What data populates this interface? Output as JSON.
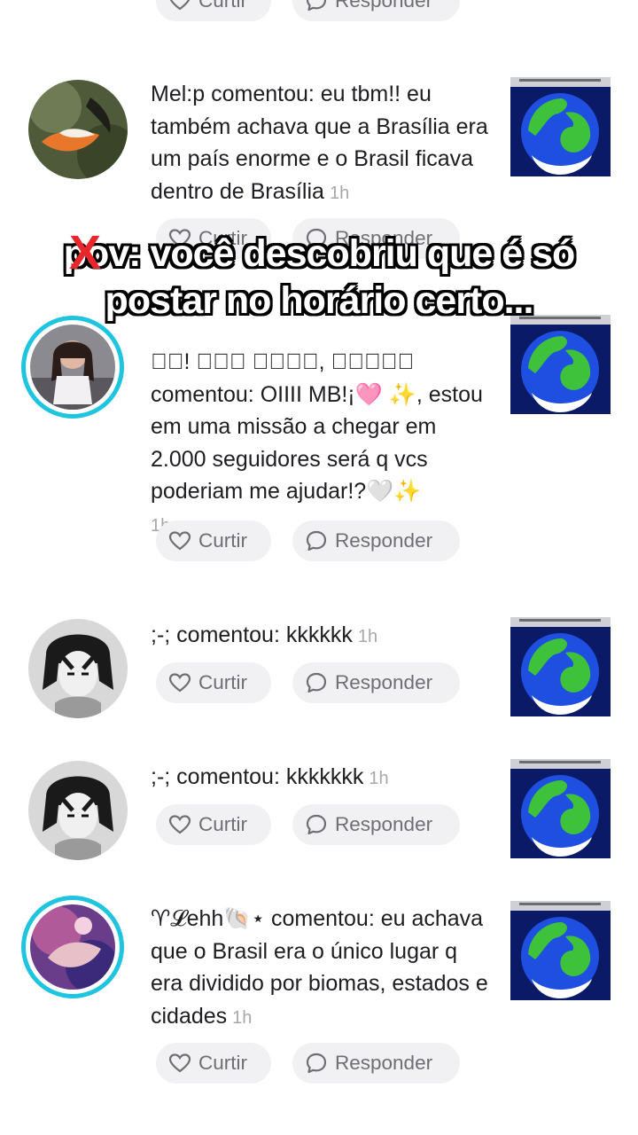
{
  "buttons": {
    "like_label": "Curtir",
    "reply_label": "Responder"
  },
  "overlay": {
    "line1_prefix": "po",
    "line1_rest": "v: você descobriu que é só",
    "line2": "postar no horário certo...",
    "strike_mark": "X"
  },
  "notifications": [
    {
      "name": "Mel:p",
      "action": " comentou: ",
      "comment": "eu tbm!! eu também achava que a Brasília era um país enorme e o Brasil ficava dentro de Brasília",
      "time": "1h"
    },
    {
      "name": "♡⃝! 𝒞𝑜𝓂 𝒶𝓂𝑜𝓇, 𝑅𝑒𝒾♡⃝",
      "action": " comentou: ",
      "comment": "OIIII MB!¡🩷 ✨, estou em uma missão a chegar em 2.000 seguidores será q vcs poderiam me ajudar!?🤍✨",
      "time": "1h"
    },
    {
      "name": ";-;",
      "action": " comentou: ",
      "comment": "kkkkkk",
      "time": "1h"
    },
    {
      "name": ";-;",
      "action": " comentou: ",
      "comment": "kkkkkkk",
      "time": "1h"
    },
    {
      "name": "♈𝓛ehh🐚⋆",
      "action": " comentou: ",
      "comment": "eu achava que o Brasil era o único lugar q era dividido por biomas, estados e cidades",
      "time": "1h"
    }
  ],
  "colors": {
    "ring": "#1fc5df",
    "thumb_bg": "#0a1a66",
    "globe_blue": "#1f4fe0",
    "globe_green": "#3fc23b",
    "strike": "#e8262b"
  }
}
